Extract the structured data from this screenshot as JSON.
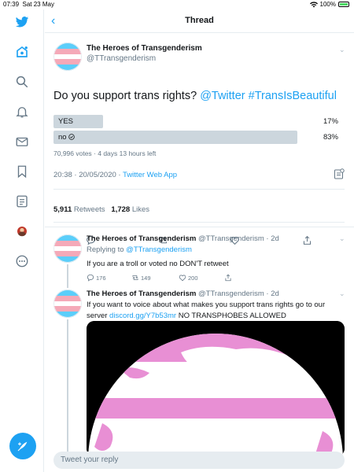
{
  "status": {
    "time": "07:39",
    "date": "Sat 23 May",
    "battery": "100%"
  },
  "header": {
    "title": "Thread",
    "back_glyph": "‹"
  },
  "colors": {
    "accent": "#1da1f2",
    "trans_blue": "#5bcefa",
    "trans_pink": "#f5a9b8"
  },
  "main_tweet": {
    "name": "The Heroes of Transgenderism",
    "handle": "@TTransgenderism",
    "text_plain": "Do you support trans rights? ",
    "mention": "@Twitter",
    "hashtag": "#TransIsBeautiful",
    "poll": {
      "options": [
        {
          "label": "YES",
          "percent_text": "17%",
          "share": 0.17,
          "winner": false
        },
        {
          "label": "no",
          "percent_text": "83%",
          "share": 0.83,
          "winner": true
        }
      ],
      "meta": "70,996 votes · 4 days 13 hours left"
    },
    "timestamp": "20:38 · 20/05/2020 · ",
    "source": "Twitter Web App",
    "retweets": "5,911",
    "retweets_label": "Retweets",
    "likes": "1,728",
    "likes_label": "Likes"
  },
  "replies": [
    {
      "name": "The Heroes of Transgenderism",
      "handle_time": " @TTransgenderism · 2d",
      "replying_prefix": "Replying to ",
      "replying_to": "@TTransgenderism",
      "text": "If you are a troll or voted no DON'T retweet",
      "reply_count": "176",
      "retweet_count": "149",
      "like_count": "200"
    },
    {
      "name": "The Heroes of Transgenderism",
      "handle_time": " @TTransgenderism · 2d",
      "text_line1": "If you want to voice about what makes you support trans rights go to our",
      "text_line2_prefix": "server ",
      "text_link": "discord.gg/Y7b53mr",
      "text_line2_suffix": " NO TRANSPHOBES ALLOWED"
    }
  ],
  "reply_bar": {
    "placeholder": "Tweet your reply"
  }
}
